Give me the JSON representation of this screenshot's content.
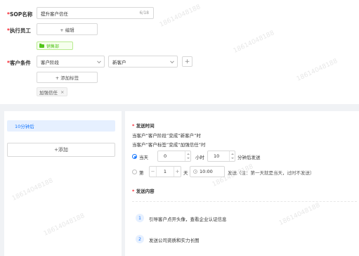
{
  "form": {
    "sop_name": {
      "label": "SOP名称",
      "value": "提升客户信任",
      "count": "6/18"
    },
    "executor": {
      "label": "执行员工",
      "edit_button": "+ 编辑",
      "dept_tag": "销售部"
    },
    "condition": {
      "label": "客户条件",
      "field_select": "客户阶段",
      "value_select": "新客户",
      "add_button": "+",
      "add_tag_button": "+ 添加标签",
      "tag": "加强信任",
      "tag_close": "×"
    },
    "required_mark": "*"
  },
  "steps": {
    "items": [
      "10分钟后"
    ],
    "add_button": "+添加"
  },
  "send_time": {
    "title": "发送时间",
    "desc1": "当客户“客户阶段”变成“新客户”时",
    "desc2": "当客户“客户标签”变成“加强信任”时",
    "option1": {
      "prefix": "当天",
      "hours": "0",
      "hours_unit": "小时",
      "minutes": "10",
      "suffix": "分钟后发送",
      "checked": true
    },
    "option2": {
      "prefix": "第",
      "day": "1",
      "day_unit": "天",
      "time": "10:00",
      "suffix": "发送（注：第一天就是当天，过时不发送）",
      "checked": false
    }
  },
  "send_content": {
    "title": "发送内容",
    "items": [
      {
        "index": "1",
        "text": "引导客户点开头像，查看企业认证信息"
      },
      {
        "index": "2",
        "text": "发送公司资质和实力长图"
      }
    ]
  },
  "colors": {
    "primary": "#1677ff",
    "required": "#f5222d",
    "success": "#52c41a",
    "page_bg": "#f0f2f5"
  }
}
